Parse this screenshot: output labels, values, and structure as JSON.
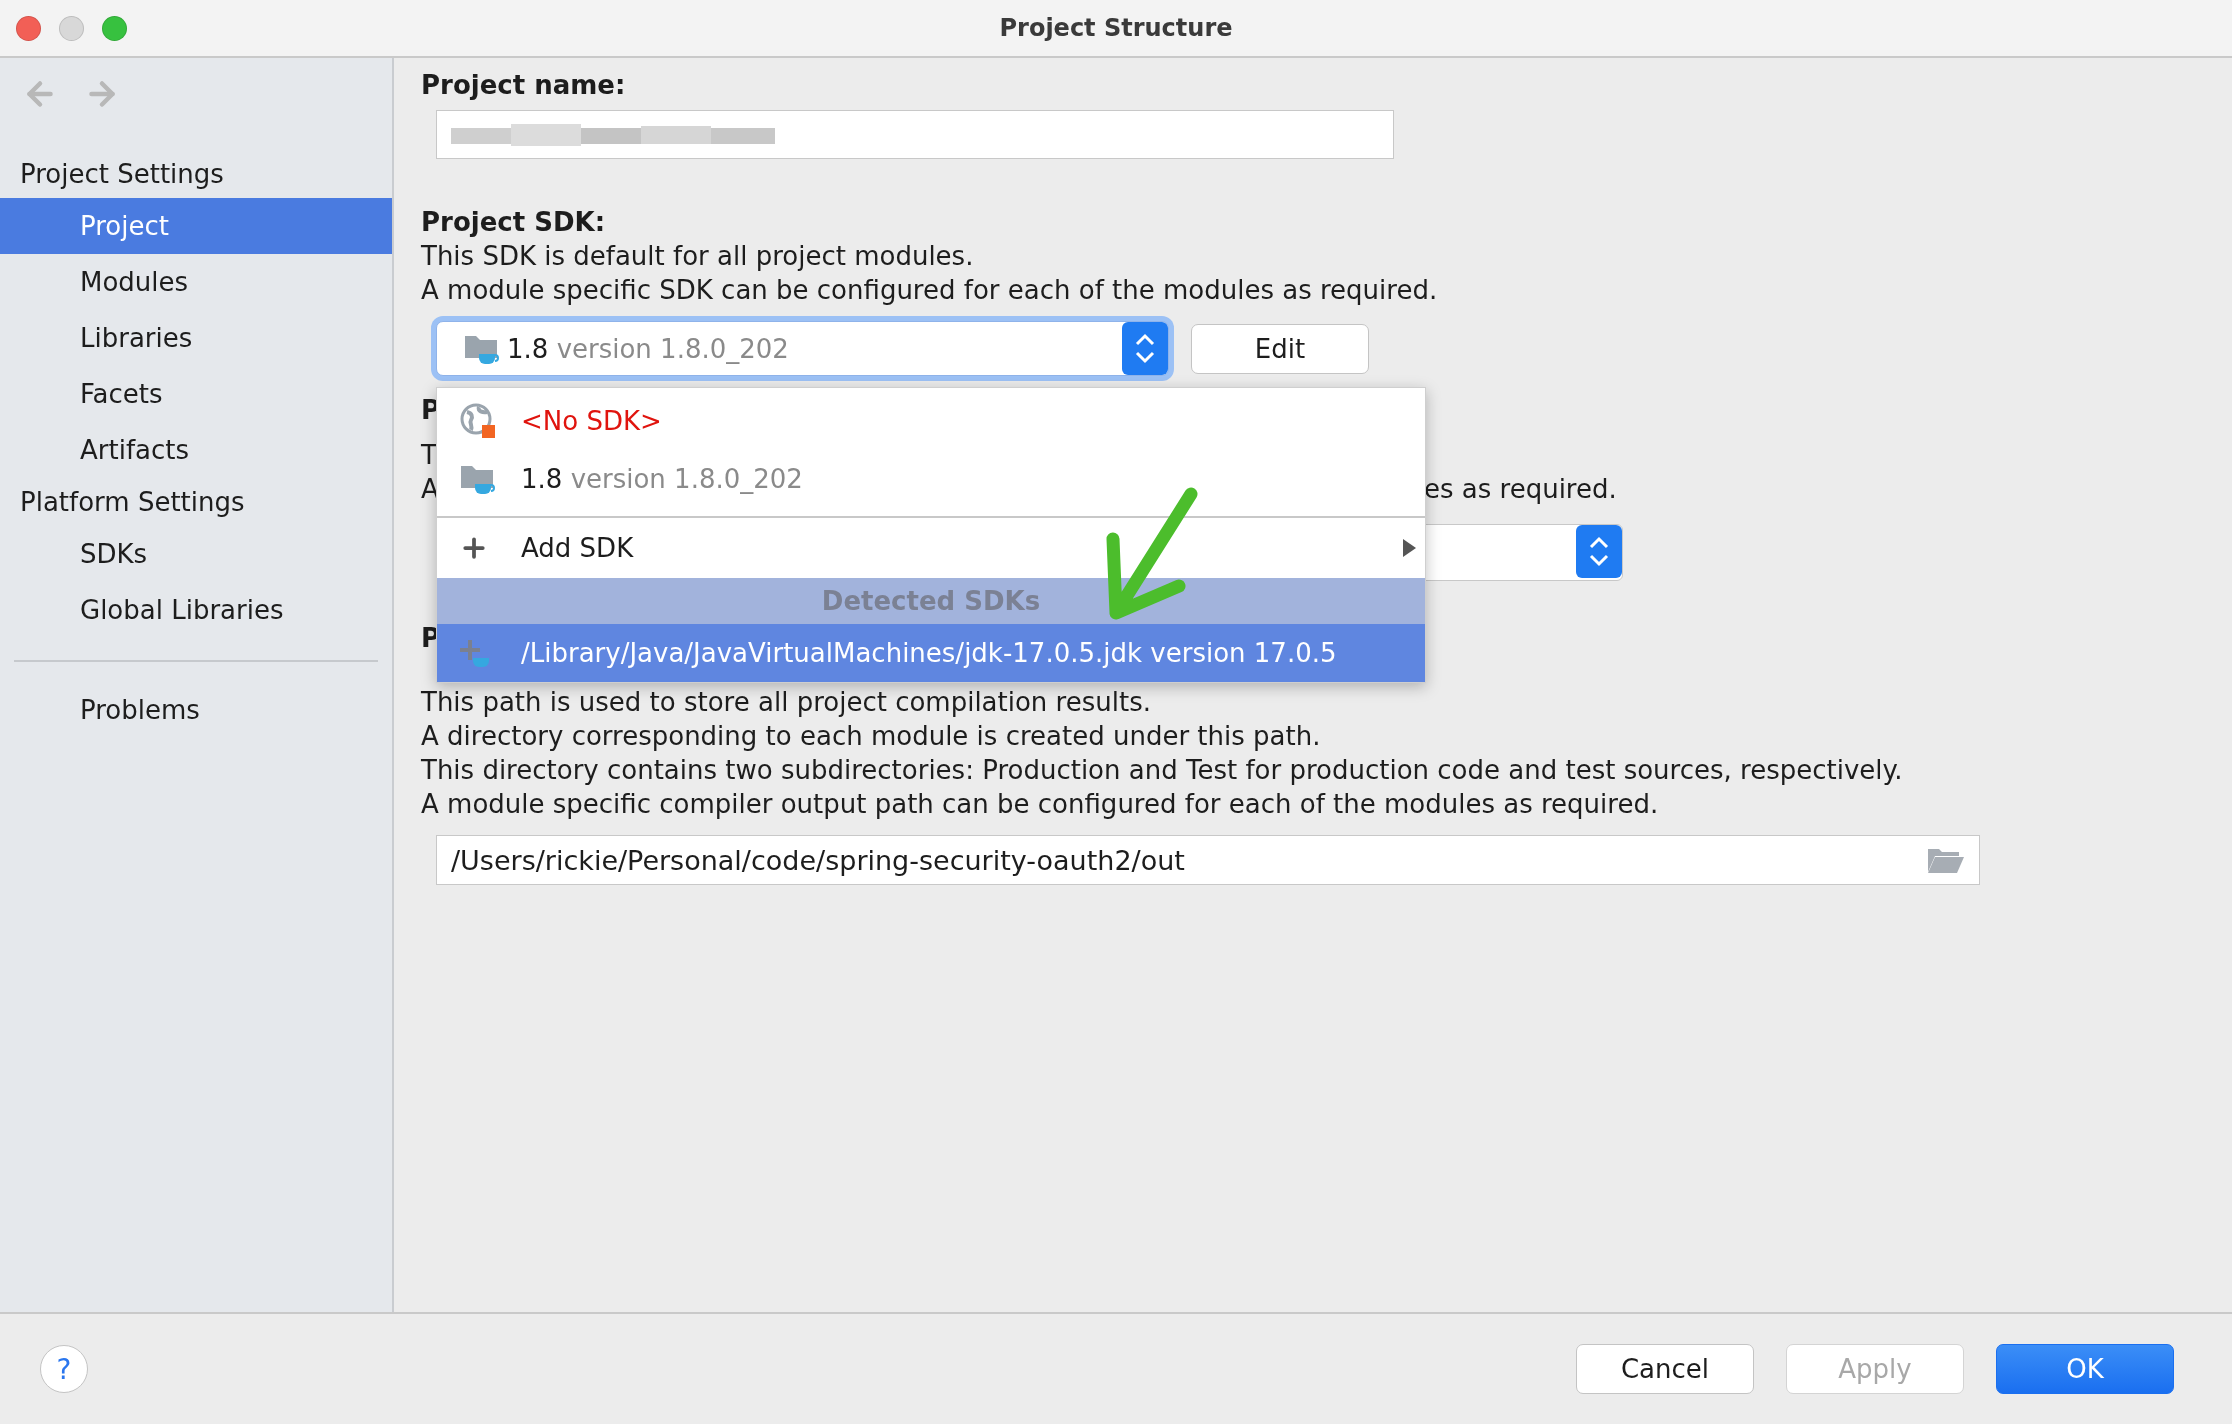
{
  "window": {
    "title": "Project Structure"
  },
  "sidebar": {
    "sections": [
      {
        "heading": "Project Settings",
        "items": [
          {
            "label": "Project",
            "selected": true
          },
          {
            "label": "Modules",
            "selected": false
          },
          {
            "label": "Libraries",
            "selected": false
          },
          {
            "label": "Facets",
            "selected": false
          },
          {
            "label": "Artifacts",
            "selected": false
          }
        ]
      },
      {
        "heading": "Platform Settings",
        "items": [
          {
            "label": "SDKs",
            "selected": false
          },
          {
            "label": "Global Libraries",
            "selected": false
          }
        ]
      }
    ],
    "footer_items": [
      {
        "label": "Problems",
        "selected": false
      }
    ]
  },
  "project_name": {
    "label": "Project name:"
  },
  "project_sdk": {
    "label": "Project SDK:",
    "description": [
      "This SDK is default for all project modules.",
      "A module specific SDK can be configured for each of the modules as required."
    ],
    "combo": {
      "name": "1.8",
      "version": "version 1.8.0_202"
    },
    "edit_button": "Edit"
  },
  "sdk_popup": {
    "items": [
      {
        "kind": "none",
        "name": "<No SDK>",
        "selected": false
      },
      {
        "kind": "jdk",
        "name": "1.8",
        "version": "version 1.8.0_202",
        "selected": false
      }
    ],
    "add_sdk": "Add SDK",
    "section_header": "Detected SDKs",
    "detected": [
      {
        "label": "/Library/Java/JavaVirtualMachines/jdk-17.0.5.jdk version 17.0.5",
        "selected": true
      }
    ]
  },
  "covered_section": {
    "heading_fragment": "P",
    "line_fragments": [
      "T",
      "A"
    ],
    "line_tail": "es as required."
  },
  "compiler_output": {
    "heading_fragment": "P",
    "description": [
      "This path is used to store all project compilation results.",
      "A directory corresponding to each module is created under this path.",
      "This directory contains two subdirectories: Production and Test for production code and test sources, respectively.",
      "A module specific compiler output path can be configured for each of the modules as required."
    ],
    "path": "/Users/rickie/Personal/code/spring-security-oauth2/out"
  },
  "help_button": "?",
  "buttons": [
    {
      "label": "Cancel",
      "kind": "default"
    },
    {
      "label": "Apply",
      "kind": "disabled"
    },
    {
      "label": "OK",
      "kind": "primary"
    }
  ]
}
